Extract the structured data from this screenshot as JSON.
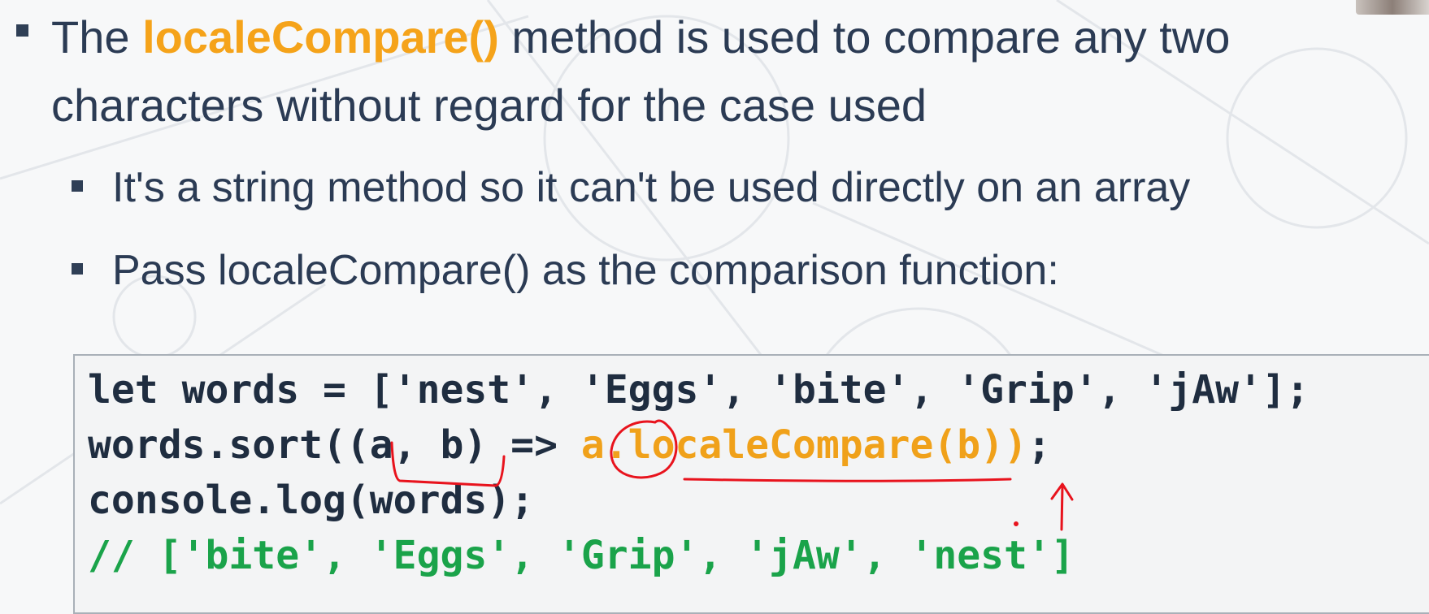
{
  "slide": {
    "bullet1": {
      "prefix": "The ",
      "highlight": "localeCompare()",
      "suffix": " method is used to compare any two characters without regard for the case used"
    },
    "bullet2": "It's a string method so it can't be used directly on an array",
    "bullet3": "Pass localeCompare() as the comparison function:"
  },
  "code": {
    "line1": "let words = ['nest', 'Eggs', 'bite', 'Grip', 'jAw'];",
    "line2_start": "words.sort((a, b) => ",
    "line2_highlight": "a.localeCompare(b))",
    "line2_end": ";",
    "line3": "console.log(words);",
    "line4": "// ['bite', 'Eggs', 'Grip', 'jAw', 'nest']"
  },
  "colors": {
    "text": "#2b3b54",
    "highlight": "#f5a31a",
    "comment": "#1aa34a",
    "annotation": "#e8131d"
  },
  "icons": {
    "presenter": "presenter-avatar"
  }
}
